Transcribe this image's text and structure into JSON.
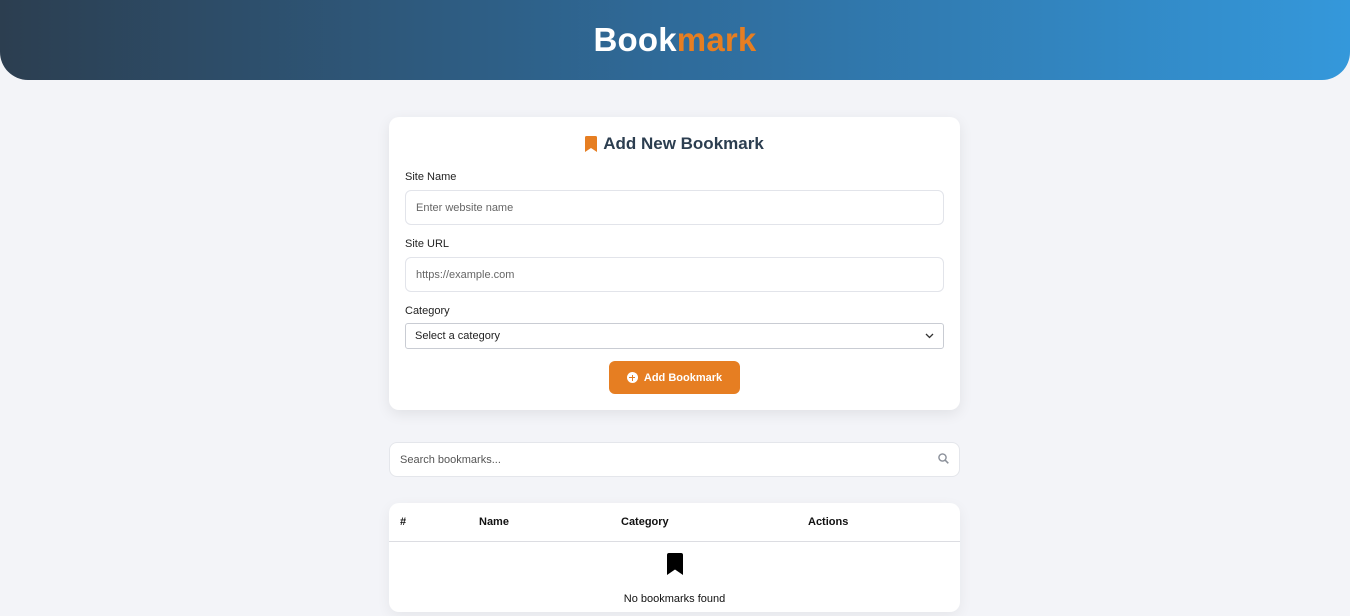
{
  "header": {
    "brand_part1": "Book",
    "brand_part2": "mark",
    "gradient_start": "#2c3e50",
    "gradient_end": "#3498db",
    "accent": "#e67e22"
  },
  "form": {
    "title": "Add New Bookmark",
    "title_icon": "bookmark-icon",
    "site_name_label": "Site Name",
    "site_name_placeholder": "Enter website name",
    "site_name_value": "",
    "site_url_label": "Site URL",
    "site_url_placeholder": "https://example.com",
    "site_url_value": "",
    "category_label": "Category",
    "category_selected": "Select a category",
    "submit_label": "Add Bookmark",
    "submit_icon": "plus-circle-icon"
  },
  "search": {
    "placeholder": "Search bookmarks...",
    "value": "",
    "icon": "search-icon"
  },
  "table": {
    "columns": [
      "#",
      "Name",
      "Category",
      "Actions"
    ],
    "rows": [],
    "empty_icon": "bookmark-icon",
    "empty_message": "No bookmarks found"
  }
}
